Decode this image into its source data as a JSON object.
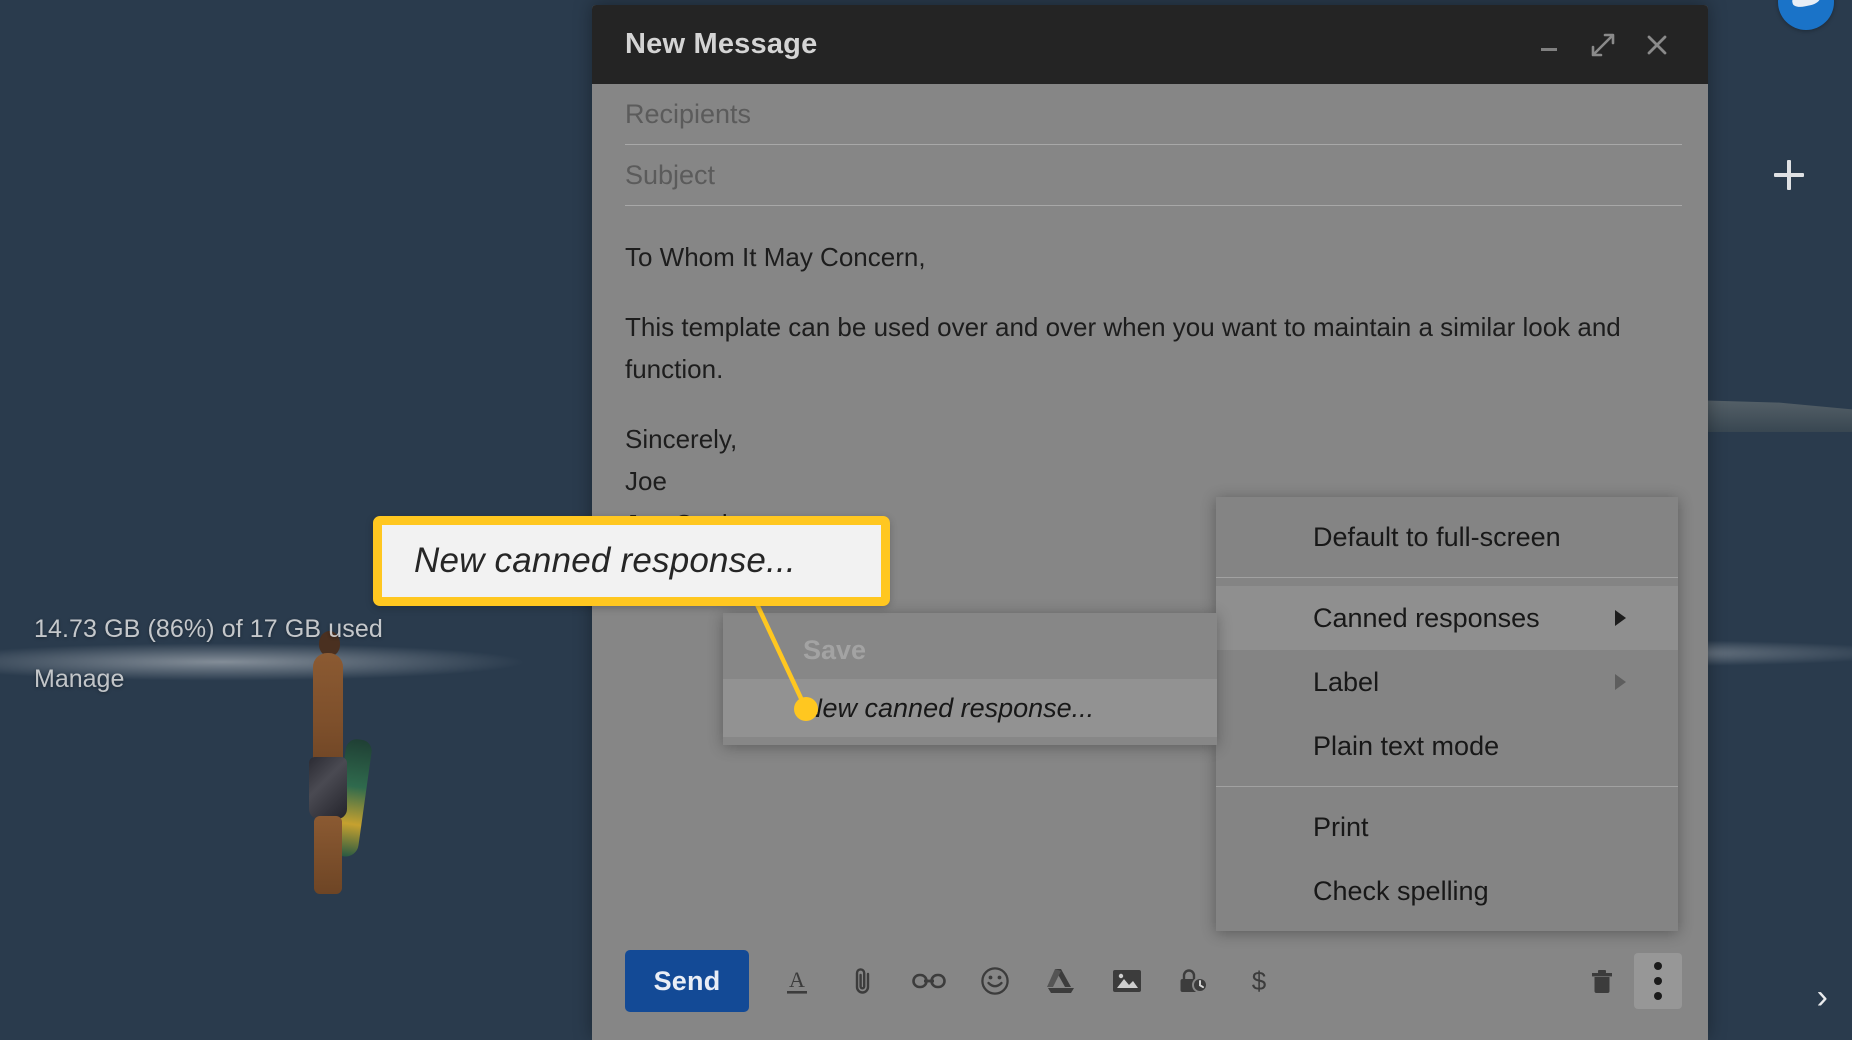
{
  "background": {
    "storage_text": "14.73 GB (86%) of 17 GB used",
    "manage_label": "Manage",
    "chevron_icon": "›"
  },
  "compose": {
    "title": "New Message",
    "window_buttons": [
      {
        "name": "minimize",
        "icon": "minimize-icon"
      },
      {
        "name": "full-screen",
        "icon": "expand-icon"
      },
      {
        "name": "close",
        "icon": "close-icon"
      }
    ],
    "recipients_placeholder": "Recipients",
    "subject_placeholder": "Subject",
    "body": {
      "salutation": "To Whom It May Concern,",
      "paragraph": "This template can be used over and over when you want to maintain a similar look and function.",
      "closing": "Sincerely,",
      "name": "Joe",
      "signature": "Joe Cool"
    },
    "toolbar": {
      "send_label": "Send",
      "icons": [
        {
          "name": "formatting-options-icon",
          "title": "Formatting options"
        },
        {
          "name": "attach-file-icon",
          "title": "Attach files"
        },
        {
          "name": "insert-link-icon",
          "title": "Insert link"
        },
        {
          "name": "insert-emoji-icon",
          "title": "Insert emoji"
        },
        {
          "name": "google-drive-icon",
          "title": "Insert files using Drive"
        },
        {
          "name": "insert-photo-icon",
          "title": "Insert photo"
        },
        {
          "name": "confidential-mode-icon",
          "title": "Toggle confidential mode"
        },
        {
          "name": "insert-money-icon",
          "title": "Insert money"
        }
      ],
      "right_icons": [
        {
          "name": "discard-draft-icon",
          "title": "Discard draft"
        },
        {
          "name": "more-options-icon",
          "title": "More options",
          "active": true
        }
      ]
    }
  },
  "context_menu": {
    "items": [
      {
        "label": "Default to full-screen",
        "submenu": false,
        "highlight": false
      },
      {
        "separator": true
      },
      {
        "label": "Canned responses",
        "submenu": true,
        "highlight": true
      },
      {
        "label": "Label",
        "submenu": true,
        "highlight": false
      },
      {
        "label": "Plain text mode",
        "submenu": false,
        "highlight": false
      },
      {
        "separator": true
      },
      {
        "label": "Print",
        "submenu": false,
        "highlight": false
      },
      {
        "label": "Check spelling",
        "submenu": false,
        "highlight": false
      }
    ]
  },
  "submenu": {
    "section_label": "Save",
    "item_label": "New canned response..."
  },
  "callout": {
    "text": "New canned response...",
    "border_color": "#ffc720",
    "fill_color": "#f2f2f2",
    "dot_color": "#ffc720"
  }
}
